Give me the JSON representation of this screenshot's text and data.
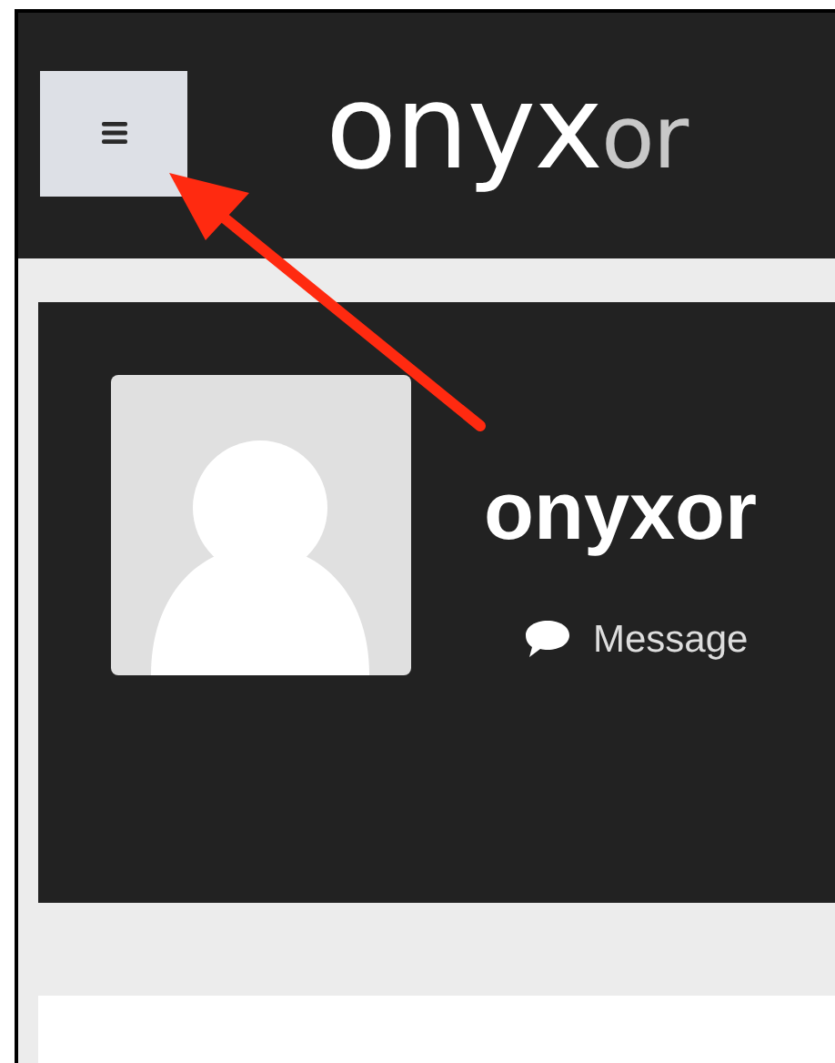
{
  "header": {
    "logo": {
      "primary": "onyx",
      "secondary": "or"
    }
  },
  "profile": {
    "name": "onyxor",
    "message_button": "Message"
  }
}
